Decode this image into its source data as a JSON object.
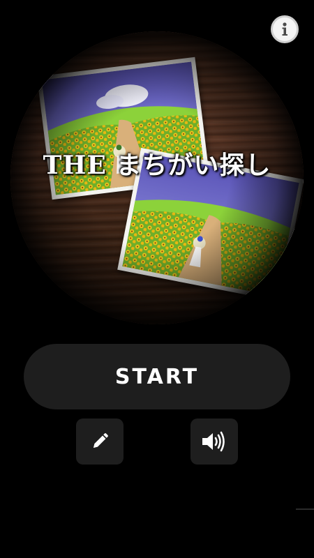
{
  "header": {
    "info_icon": "info-icon"
  },
  "hero": {
    "title": "THE まちがい探し",
    "images": [
      "sunflower-field-girl-picture",
      "sunflower-field-girl-picture-variant"
    ]
  },
  "menu": {
    "start_label": "START",
    "edit_icon": "pencil-icon",
    "sound_icon": "speaker-volume-icon"
  },
  "colors": {
    "background": "#000000",
    "button": "#1e1e1e",
    "text": "#ffffff",
    "info_button": "#f4f4f4"
  }
}
